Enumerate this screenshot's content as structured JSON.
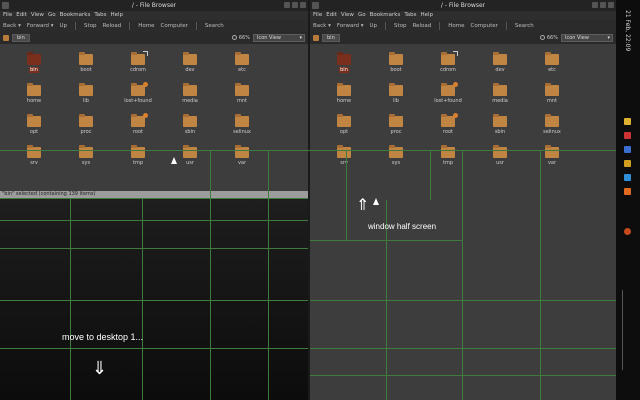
{
  "left_window": {
    "title": "/ - File Browser",
    "menu": [
      "File",
      "Edit",
      "View",
      "Go",
      "Bookmarks",
      "Tabs",
      "Help"
    ],
    "toolbar": [
      "Back ▾",
      "Forward ▾",
      "Up",
      "Stop",
      "Reload",
      "Home",
      "Computer",
      "Search"
    ],
    "location": "bin",
    "zoom": "66%",
    "view_mode": "Icon View",
    "status": "\"bin\" selected (containing 139 items)",
    "items": [
      {
        "label": "bin",
        "selected": true,
        "emblem": ""
      },
      {
        "label": "boot",
        "selected": false,
        "emblem": ""
      },
      {
        "label": "cdrom",
        "selected": false,
        "emblem": "link"
      },
      {
        "label": "dev",
        "selected": false,
        "emblem": ""
      },
      {
        "label": "etc",
        "selected": false,
        "emblem": ""
      },
      {
        "label": "home",
        "selected": false,
        "emblem": ""
      },
      {
        "label": "lib",
        "selected": false,
        "emblem": ""
      },
      {
        "label": "lost+found",
        "selected": false,
        "emblem": "lock"
      },
      {
        "label": "media",
        "selected": false,
        "emblem": ""
      },
      {
        "label": "mnt",
        "selected": false,
        "emblem": ""
      },
      {
        "label": "opt",
        "selected": false,
        "emblem": ""
      },
      {
        "label": "proc",
        "selected": false,
        "emblem": ""
      },
      {
        "label": "root",
        "selected": false,
        "emblem": "lock"
      },
      {
        "label": "sbin",
        "selected": false,
        "emblem": ""
      },
      {
        "label": "selinux",
        "selected": false,
        "emblem": ""
      },
      {
        "label": "srv",
        "selected": false,
        "emblem": ""
      },
      {
        "label": "sys",
        "selected": false,
        "emblem": ""
      },
      {
        "label": "tmp",
        "selected": false,
        "emblem": ""
      },
      {
        "label": "usr",
        "selected": false,
        "emblem": ""
      },
      {
        "label": "var",
        "selected": false,
        "emblem": ""
      }
    ]
  },
  "right_window": {
    "title": "/ - File Browser",
    "menu": [
      "File",
      "Edit",
      "View",
      "Go",
      "Bookmarks",
      "Tabs",
      "Help"
    ],
    "toolbar": [
      "Back ▾",
      "Forward ▾",
      "Up",
      "Stop",
      "Reload",
      "Home",
      "Computer",
      "Search"
    ],
    "location": "bin",
    "zoom": "66%",
    "view_mode": "Icon View",
    "items": [
      {
        "label": "bin",
        "selected": true,
        "emblem": ""
      },
      {
        "label": "boot",
        "selected": false,
        "emblem": ""
      },
      {
        "label": "cdrom",
        "selected": false,
        "emblem": "link"
      },
      {
        "label": "dev",
        "selected": false,
        "emblem": ""
      },
      {
        "label": "etc",
        "selected": false,
        "emblem": ""
      },
      {
        "label": "home",
        "selected": false,
        "emblem": ""
      },
      {
        "label": "lib",
        "selected": false,
        "emblem": ""
      },
      {
        "label": "lost+found",
        "selected": false,
        "emblem": "lock"
      },
      {
        "label": "media",
        "selected": false,
        "emblem": ""
      },
      {
        "label": "mnt",
        "selected": false,
        "emblem": ""
      },
      {
        "label": "opt",
        "selected": false,
        "emblem": ""
      },
      {
        "label": "proc",
        "selected": false,
        "emblem": ""
      },
      {
        "label": "root",
        "selected": false,
        "emblem": "lock"
      },
      {
        "label": "sbin",
        "selected": false,
        "emblem": ""
      },
      {
        "label": "selinux",
        "selected": false,
        "emblem": ""
      },
      {
        "label": "srv",
        "selected": false,
        "emblem": ""
      },
      {
        "label": "sys",
        "selected": false,
        "emblem": ""
      },
      {
        "label": "tmp",
        "selected": false,
        "emblem": ""
      },
      {
        "label": "usr",
        "selected": false,
        "emblem": ""
      },
      {
        "label": "var",
        "selected": false,
        "emblem": ""
      }
    ]
  },
  "annotations": {
    "move_to_desktop": "move to desktop 1...",
    "window_half_screen": "window half screen"
  },
  "panel": {
    "clock": "21 Feb, 22:09"
  },
  "colors": {
    "folder": "#c08443",
    "selected_folder": "#7a2e1c",
    "grid_line": "#3f7a3f",
    "status_bar": "#9c9c9c"
  }
}
